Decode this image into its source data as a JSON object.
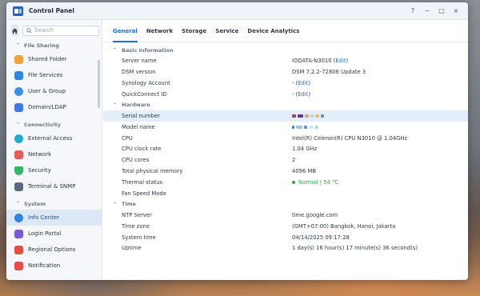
{
  "window": {
    "title": "Control Panel",
    "help": "?",
    "minimize": "−",
    "maximize": "□",
    "close": "×"
  },
  "sidebar": {
    "search_placeholder": "Search",
    "groups": [
      {
        "label": "File Sharing",
        "items": [
          {
            "label": "Shared Folder",
            "icon": "shared-folder-icon",
            "color": "#f2a23a"
          },
          {
            "label": "File Services",
            "icon": "file-services-icon",
            "color": "#2f86dd"
          },
          {
            "label": "User & Group",
            "icon": "user-group-icon",
            "color": "#3a8ee6"
          },
          {
            "label": "Domain/LDAP",
            "icon": "domain-ldap-icon",
            "color": "#3d7be0"
          }
        ]
      },
      {
        "label": "Connectivity",
        "items": [
          {
            "label": "External Access",
            "icon": "external-access-icon",
            "color": "#27a9c9"
          },
          {
            "label": "Network",
            "icon": "network-icon",
            "color": "#e35c5c"
          },
          {
            "label": "Security",
            "icon": "security-icon",
            "color": "#38b56a"
          },
          {
            "label": "Terminal & SNMP",
            "icon": "terminal-icon",
            "color": "#5b6b7d"
          }
        ]
      },
      {
        "label": "System",
        "items": [
          {
            "label": "Info Center",
            "icon": "info-center-icon",
            "color": "#2f86dd",
            "active": true
          },
          {
            "label": "Login Portal",
            "icon": "login-portal-icon",
            "color": "#7d5bd6"
          },
          {
            "label": "Regional Options",
            "icon": "regional-options-icon",
            "color": "#e0513f"
          },
          {
            "label": "Notification",
            "icon": "notification-icon",
            "color": "#e94c4c"
          }
        ]
      }
    ]
  },
  "tabs": [
    "General",
    "Network",
    "Storage",
    "Service",
    "Device Analytics"
  ],
  "sections": {
    "basic": {
      "title": "Basic Information",
      "server_name_label": "Server name",
      "server_name_value": "IODATA-N3010",
      "edit": "Edit",
      "dsm_label": "DSM version",
      "dsm_value": "DSM 7.2.2-72806 Update 3",
      "synology_label": "Synology Account",
      "synology_value": "-",
      "quickconnect_label": "QuickConnect ID",
      "quickconnect_value": "-"
    },
    "hardware": {
      "title": "Hardware",
      "serial_label": "Serial number",
      "model_label": "Model name",
      "cpu_label": "CPU",
      "cpu_value": "Intel(R) Celeron(R) CPU N3010 @ 1.04GHz",
      "clock_label": "CPU clock rate",
      "clock_value": "1.04 GHz",
      "cores_label": "CPU cores",
      "cores_value": "2",
      "memory_label": "Total physical memory",
      "memory_value": "4096 MB",
      "thermal_label": "Thermal status",
      "thermal_value": "Normal | 54 °C",
      "fan_label": "Fan Speed Mode",
      "fan_value": ""
    },
    "time": {
      "title": "Time",
      "ntp_label": "NTP Server",
      "ntp_value": "time.google.com",
      "zone_label": "Time zone",
      "zone_value": "(GMT+07:00) Bangkok, Hanoi, Jakarta",
      "systime_label": "System time",
      "systime_value": "04/14/2025 09:17:28",
      "uptime_label": "Uptime",
      "uptime_value": "1 day(s) 16 hour(s) 17 minute(s) 36 second(s)"
    }
  }
}
